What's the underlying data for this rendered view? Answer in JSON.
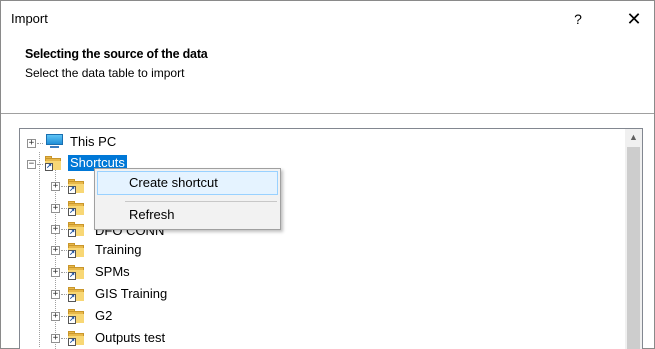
{
  "window": {
    "title": "Import",
    "help_glyph": "?",
    "close_glyph": "✕"
  },
  "header": {
    "title": "Selecting the source of the data",
    "subtitle": "Select the data table to import"
  },
  "tree": {
    "root": {
      "label": "This PC",
      "expander": "+"
    },
    "shortcuts": {
      "label": "Shortcuts",
      "expander": "−"
    },
    "hidden_label": "DFO CONN",
    "children": [
      {
        "label": "Training",
        "expander": "+"
      },
      {
        "label": "SPMs",
        "expander": "+"
      },
      {
        "label": "GIS Training",
        "expander": "+"
      },
      {
        "label": "G2",
        "expander": "+"
      },
      {
        "label": "Outputs test",
        "expander": "+"
      }
    ],
    "covered_expanders": [
      "+",
      "+",
      "+"
    ]
  },
  "context_menu": {
    "items": [
      "Create shortcut",
      "Refresh"
    ]
  },
  "scrollbar": {
    "up_glyph": "▲"
  },
  "colors": {
    "selection": "#0078d7",
    "menu_hover": "#e5f3ff",
    "folder": "#f8d775"
  }
}
